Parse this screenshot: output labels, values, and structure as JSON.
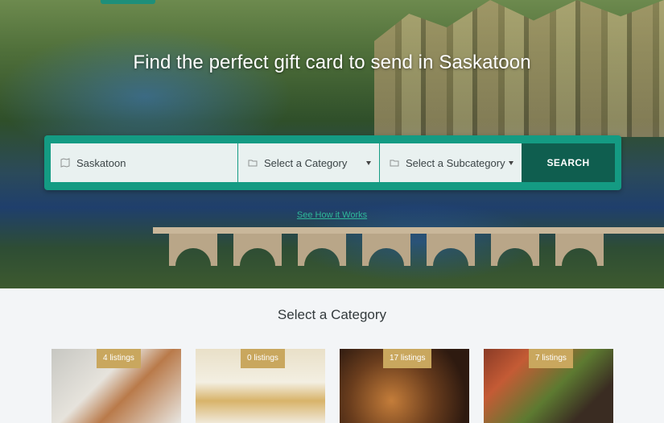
{
  "hero": {
    "title": "Find the perfect gift card to send in Saskatoon",
    "how_it_works": "See How it Works"
  },
  "search": {
    "location_value": "Saskatoon",
    "category_selected": "Select a Category",
    "subcategory_selected": "Select a Subcategory",
    "button_label": "SEARCH"
  },
  "categories": {
    "title": "Select a Category",
    "cards": [
      {
        "listings": "4 listings"
      },
      {
        "listings": "0 listings"
      },
      {
        "listings": "17 listings"
      },
      {
        "listings": "7 listings"
      }
    ]
  },
  "colors": {
    "accent": "#149b83",
    "button": "#0f5e4f",
    "badge": "#c9a75e",
    "link": "#2fb89a"
  }
}
